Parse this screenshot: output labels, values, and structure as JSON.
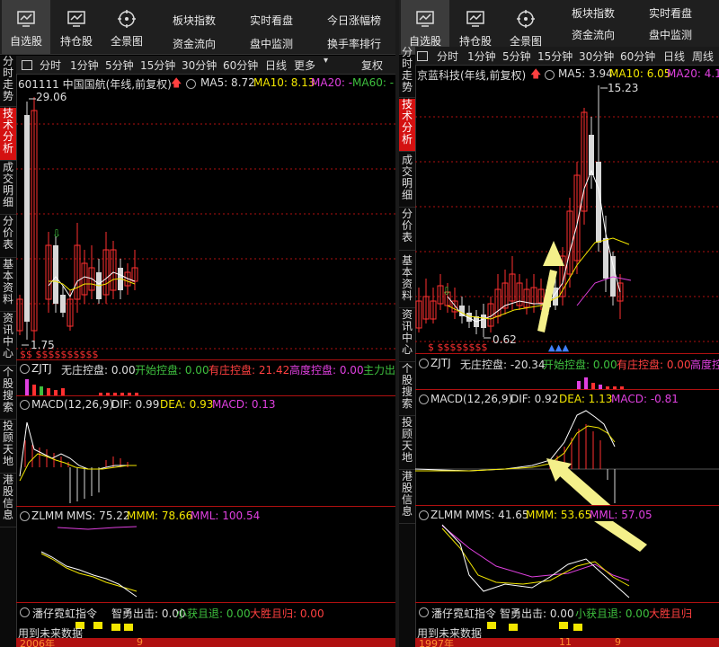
{
  "left": {
    "nav": {
      "buttons": [
        "自选股",
        "持仓股",
        "全景图"
      ],
      "links_row1": [
        "板块指数",
        "实时看盘",
        "今日涨幅榜"
      ],
      "links_row2": [
        "资金流向",
        "盘中监测",
        "换手率排行"
      ]
    },
    "side_tabs": [
      "分时走势",
      "技术分析",
      "成交明细",
      "分价表",
      "基本资料",
      "资讯中心",
      "个股搜索",
      "投顾天地",
      "港股信息"
    ],
    "periods": [
      "分时",
      "1分钟",
      "5分钟",
      "15分钟",
      "30分钟",
      "60分钟",
      "日线",
      "更多",
      "复权"
    ],
    "price": {
      "stock": "601111 中国国航(年线,前复权)",
      "ma5": "MA5: 8.72",
      "ma10": "MA10: 8.13",
      "ma20": "MA20: -",
      "ma60": "MA60: -",
      "high": "29.06",
      "low": "1.75"
    },
    "zjtj": {
      "name": "ZJTJ",
      "a": "无庄控盘: 0.00",
      "b": "开始控盘: 0.00",
      "c": "有庄控盘: 21.42",
      "d": "高度控盘: 0.00",
      "e": "主力出"
    },
    "macd": {
      "name": "MACD(12,26,9)",
      "dif": "DIF: 0.99",
      "dea": "DEA: 0.93",
      "macd": "MACD: 0.13"
    },
    "zlmm": {
      "name": "ZLMM",
      "mms": "MMS: 75.22",
      "mmm": "MMM: 78.66",
      "mml": "MML: 100.54"
    },
    "rainbow": {
      "name": "潘仔霓虹指令",
      "a": "智勇出击: 0.00",
      "b": "小获且退: 0.00",
      "c": "大胜且归: 0.00"
    },
    "bottom": {
      "a": "用到未来数据",
      "b": "2006年",
      "c": "9"
    }
  },
  "right": {
    "nav": {
      "buttons": [
        "自选股",
        "持仓股",
        "全景图"
      ],
      "links_row1": [
        "板块指数",
        "实时看盘"
      ],
      "links_row2": [
        "资金流向",
        "盘中监测"
      ]
    },
    "side_tabs": [
      "分时走势",
      "技术分析",
      "成交明细",
      "分价表",
      "基本资料",
      "资讯中心",
      "个股搜索",
      "投顾天地",
      "港股信息"
    ],
    "periods": [
      "分时",
      "1分钟",
      "5分钟",
      "15分钟",
      "30分钟",
      "60分钟",
      "日线",
      "周线"
    ],
    "price": {
      "stock": "京蓝科技(年线,前复权)",
      "ma5": "MA5: 3.94",
      "ma10": "MA10: 6.05",
      "ma20": "MA20: 4.1",
      "high": "15.23",
      "low": "0.62"
    },
    "zjtj": {
      "name": "ZJTJ",
      "a": "无庄控盘: -20.34",
      "b": "开始控盘: 0.00",
      "c": "有庄控盘: 0.00",
      "d": "高度控盘"
    },
    "macd": {
      "name": "MACD(12,26,9)",
      "dif": "DIF: 0.92",
      "dea": "DEA: 1.13",
      "macd": "MACD: -0.81"
    },
    "zlmm": {
      "name": "ZLMM",
      "mms": "MMS: 41.65",
      "mmm": "MMM: 53.65",
      "mml": "MML: 57.05"
    },
    "rainbow": {
      "name": "潘仔霓虹指令",
      "a": "智勇出击: 0.00",
      "b": "小获且退: 0.00",
      "c": "大胜且归"
    },
    "bottom": {
      "a": "用到未来数据",
      "b": "1997年",
      "c": "11",
      "d": "9"
    }
  },
  "colors": {
    "up": "#ff3030",
    "down": "#d8d8d8",
    "ma5": "#ffffff",
    "ma10": "#f2e600",
    "ma20": "#e040e0",
    "accent": "#d41111",
    "arrow": "#f4f08a"
  }
}
